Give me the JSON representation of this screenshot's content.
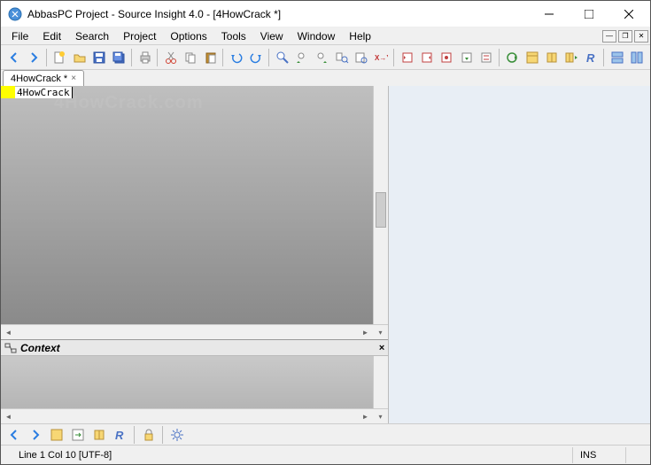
{
  "title": "AbbasPC Project - Source Insight 4.0 - [4HowCrack *]",
  "menu": [
    "File",
    "Edit",
    "Search",
    "Project",
    "Options",
    "Tools",
    "View",
    "Window",
    "Help"
  ],
  "tab": {
    "label": "4HowCrack *"
  },
  "editor": {
    "text": "4HowCrack"
  },
  "context": {
    "title": "Context"
  },
  "status": {
    "position": "Line 1  Col 10   [UTF-8]",
    "ins": "INS"
  },
  "watermark": "4HowCrack.com"
}
